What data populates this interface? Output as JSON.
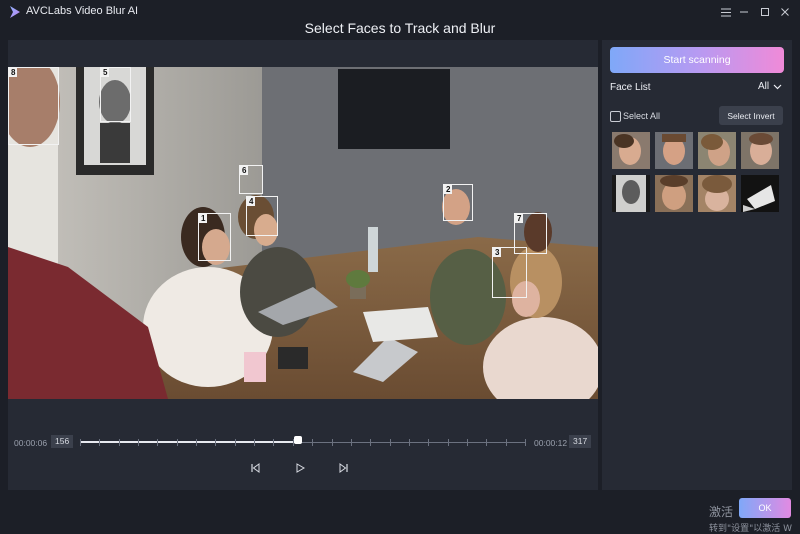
{
  "app": {
    "title": "AVCLabs Video Blur AI",
    "page_title": "Select Faces to Track and Blur",
    "colors": {
      "accent_start": "#7fa8f8",
      "accent_end": "#f08ad8",
      "panel": "#262a34",
      "background": "#1c1f27"
    }
  },
  "window_controls": {
    "menu_icon": "menu-icon",
    "minimize_icon": "minimize-icon",
    "maximize_icon": "maximize-icon",
    "close_icon": "close-icon"
  },
  "video": {
    "face_labels": [
      "1",
      "2",
      "3",
      "4",
      "5",
      "6",
      "7",
      "8"
    ]
  },
  "timeline": {
    "start_time": "00:00:06",
    "start_frame": "156",
    "end_time": "00:00:12",
    "end_frame": "317",
    "progress": 0.49
  },
  "playback": {
    "prev_icon": "skip-back-icon",
    "play_icon": "play-icon",
    "next_icon": "skip-forward-icon"
  },
  "sidebar": {
    "scan_button": "Start scanning",
    "face_list_label": "Face List",
    "filter_value": "All",
    "select_all_label": "Select All",
    "select_invert_button": "Select Invert",
    "face_thumbnail_count": 8
  },
  "footer": {
    "ok_button": "OK",
    "watermark_line1": "激活",
    "watermark_line2": "转到\"设置\"以激活 W"
  }
}
